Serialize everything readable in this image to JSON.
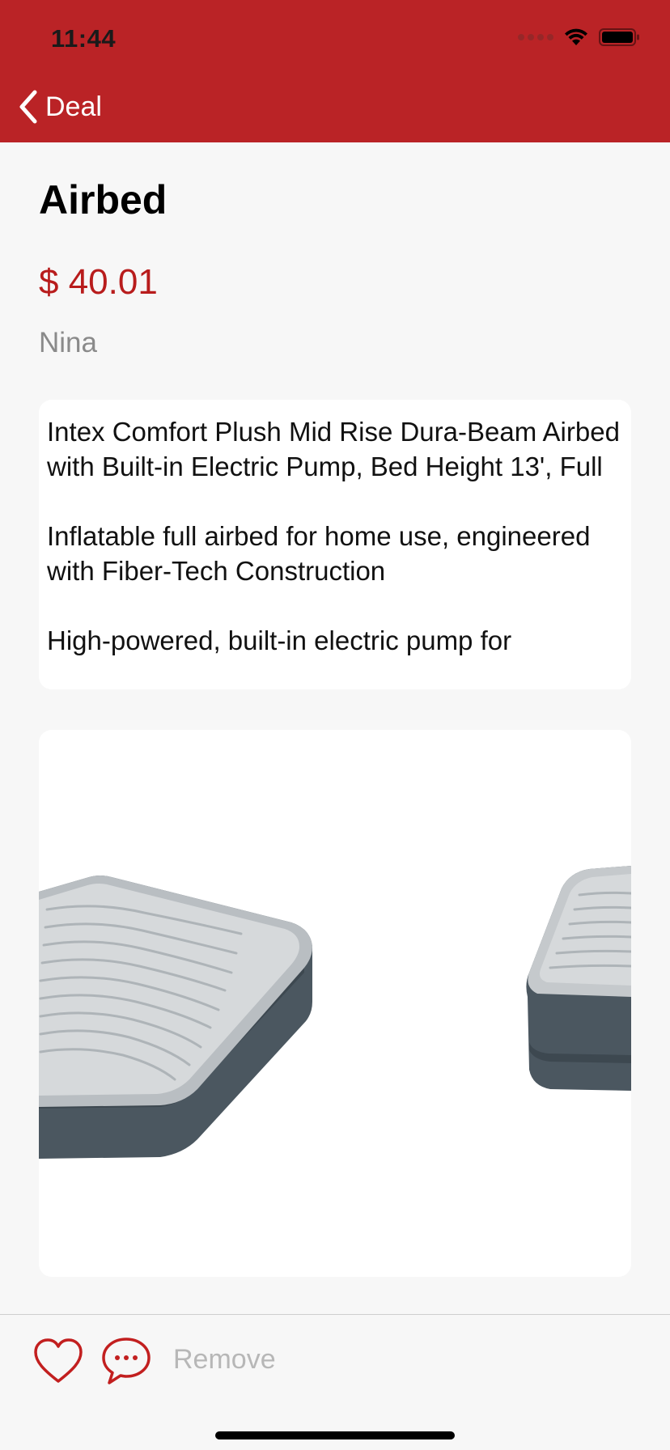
{
  "status_bar": {
    "time": "11:44"
  },
  "nav": {
    "back_label": "Deal"
  },
  "item": {
    "title": "Airbed",
    "price": "$ 40.01",
    "seller": "Nina",
    "description": "Intex Comfort Plush Mid Rise Dura-Beam Airbed with Built-in Electric Pump, Bed Height 13', Full\n\nInflatable full airbed for home use, engineered with Fiber-Tech Construction\n\nHigh-powered, built-in electric pump for"
  },
  "actions": {
    "remove_label": "Remove"
  },
  "colors": {
    "header": "#ba2326",
    "price": "#b81c1c",
    "accent_icon": "#c21f1f"
  }
}
